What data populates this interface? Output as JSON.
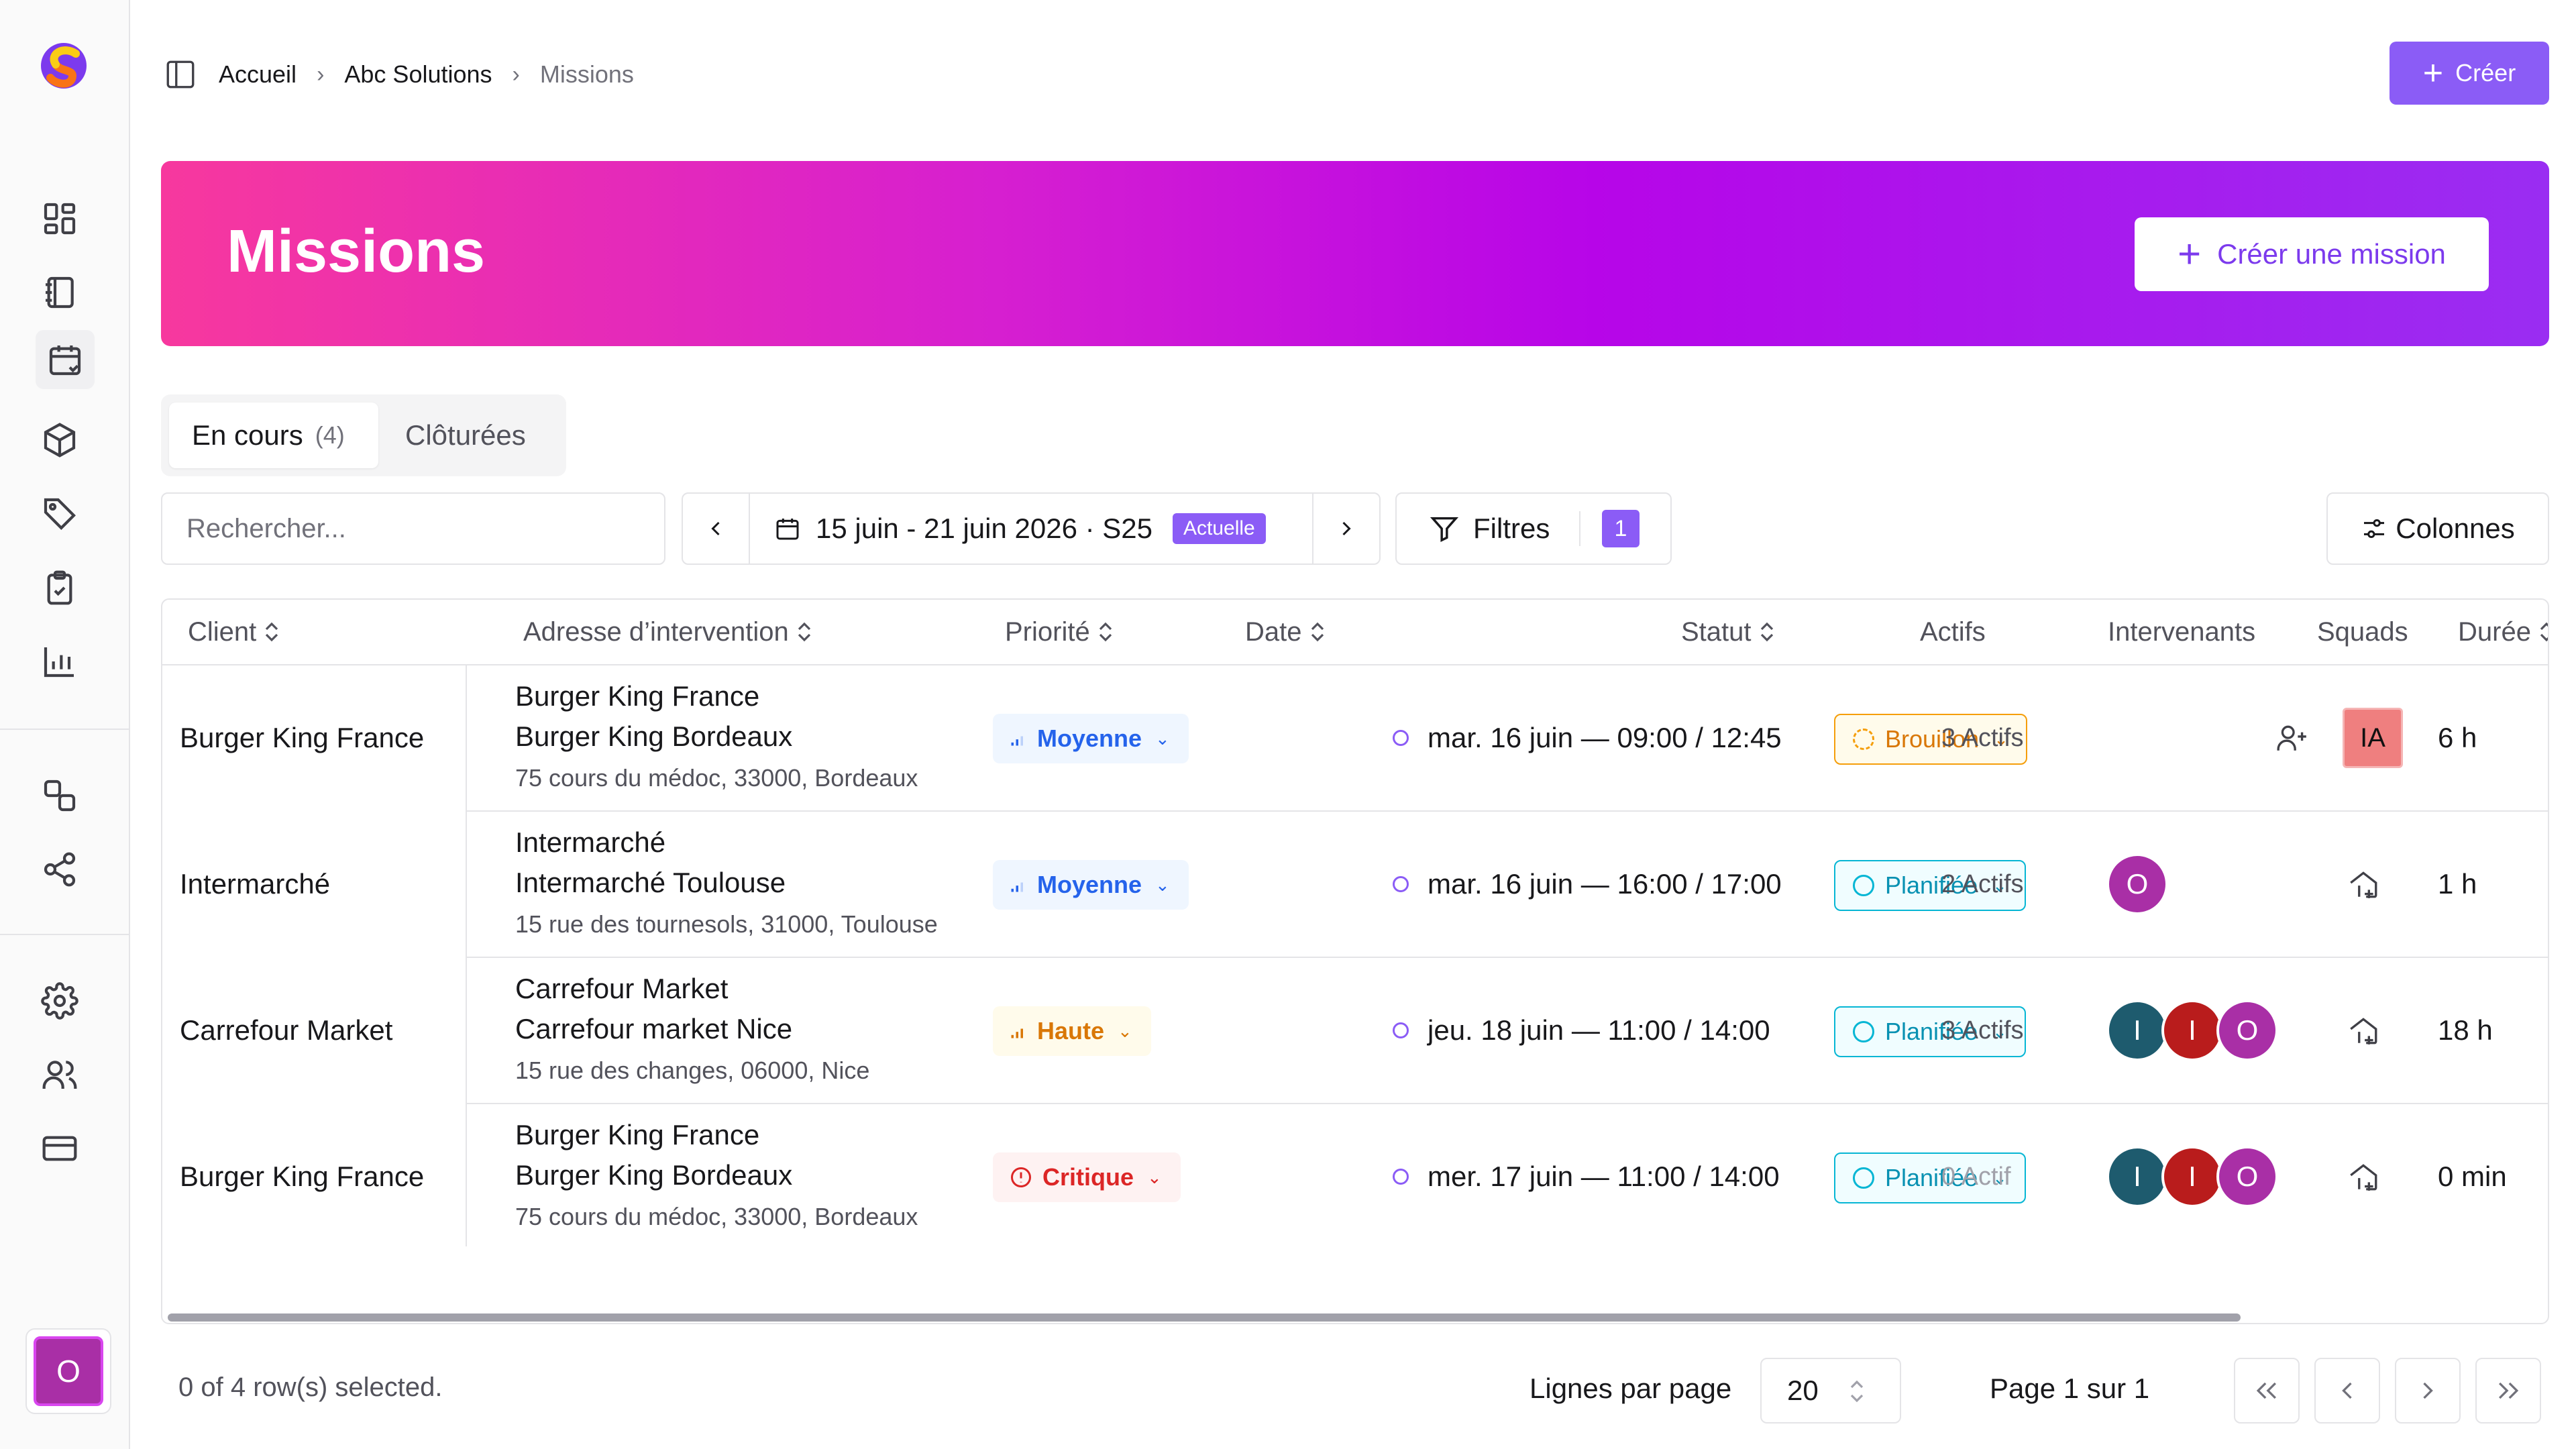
{
  "breadcrumb": {
    "home": "Accueil",
    "org": "Abc Solutions",
    "current": "Missions"
  },
  "header": {
    "create_label": "Créer"
  },
  "banner": {
    "title": "Missions",
    "button_label": "Créer une mission"
  },
  "tabs": {
    "active_label": "En cours",
    "active_count": "(4)",
    "inactive_label": "Clôturées"
  },
  "search": {
    "placeholder": "Rechercher..."
  },
  "date_range": {
    "label": "15 juin - 21 juin 2026 · S25",
    "badge": "Actuelle"
  },
  "filters": {
    "label": "Filtres",
    "count": "1"
  },
  "columns_button": "Colonnes",
  "table": {
    "headers": [
      "Client",
      "Adresse d’intervention",
      "Priorité",
      "Date",
      "Statut",
      "Actifs",
      "Intervenants",
      "Squads",
      "Durée"
    ],
    "rows": [
      {
        "client": "Burger King France",
        "addr1": "Burger King France",
        "addr2": "Burger King Bordeaux",
        "addr3": "75 cours du médoc, 33000, Bordeaux",
        "priority": "Moyenne",
        "date": "mar. 16 juin — 09:00 / 12:45",
        "status": "Brouillon",
        "actifs": "3 Actifs",
        "squad": "IA",
        "duree": "6 h"
      },
      {
        "client": "Intermarché",
        "addr1": "Intermarché",
        "addr2": "Intermarché Toulouse",
        "addr3": "15 rue des tournesols, 31000, Toulouse",
        "priority": "Moyenne",
        "date": "mar. 16 juin — 16:00 / 17:00",
        "status": "Planifiée",
        "actifs": "2 Actifs",
        "avatars": [
          "O"
        ],
        "duree": "1 h"
      },
      {
        "client": "Carrefour Market",
        "addr1": "Carrefour Market",
        "addr2": "Carrefour market Nice",
        "addr3": "15 rue des changes, 06000, Nice",
        "priority": "Haute",
        "date": "jeu. 18 juin — 11:00 / 14:00",
        "status": "Planifiée",
        "actifs": "3 Actifs",
        "avatars": [
          "I",
          "I",
          "O"
        ],
        "duree": "18 h"
      },
      {
        "client": "Burger King France",
        "addr1": "Burger King France",
        "addr2": "Burger King Bordeaux",
        "addr3": "75 cours du médoc, 33000, Bordeaux",
        "priority": "Critique",
        "date": "mer. 17 juin — 11:00 / 14:00",
        "status": "Planifiée",
        "actifs": "0 Actif",
        "avatars": [
          "I",
          "I",
          "O"
        ],
        "duree": "0 min"
      }
    ]
  },
  "footer": {
    "selected": "0 of 4 row(s) selected.",
    "rows_per_page_label": "Lignes par page",
    "rows_per_page_value": "20",
    "page_info": "Page 1 sur 1"
  },
  "user": {
    "initial": "O"
  },
  "colors": {
    "accent": "#8b5cf6",
    "banner_start": "#f7389e",
    "banner_end": "#9a2df2"
  },
  "icons": [
    "logo",
    "dashboard-icon",
    "notebook-icon",
    "calendar-icon",
    "box-icon",
    "tag-icon",
    "clipboard-check-icon",
    "bar-chart-icon",
    "shapes-icon",
    "share-icon",
    "gear-icon",
    "users-icon",
    "credit-card-icon"
  ]
}
